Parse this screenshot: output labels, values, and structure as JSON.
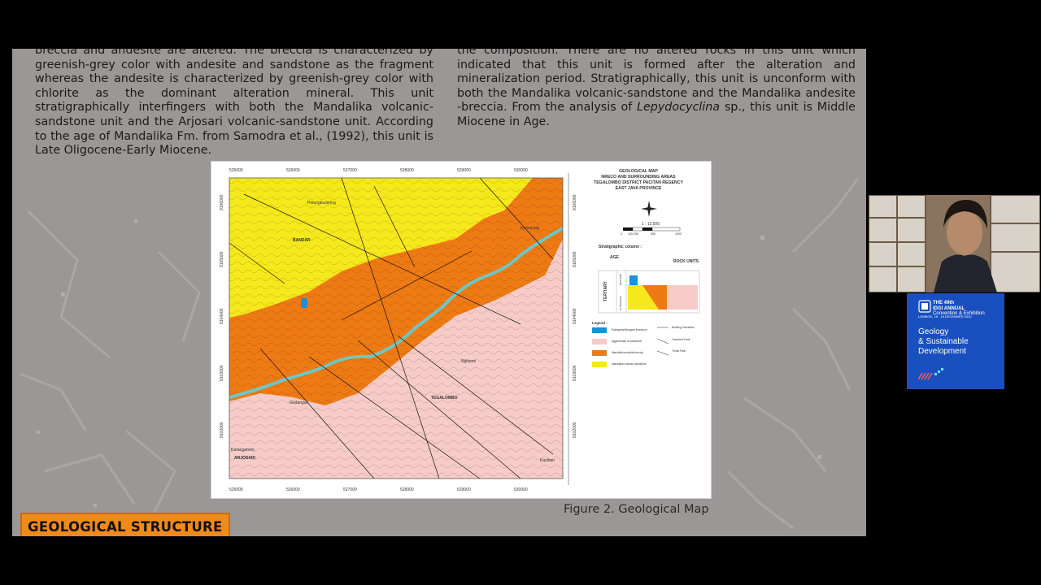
{
  "left_column": {
    "paragraph": "breccia and andesite are altered. The breccia is characterized by greenish-grey color with andesite and sandstone as the fragment whereas the andesite is characterized by greenish-grey color with chlorite as the dominant alteration mineral. This unit stratigraphically interfingers with both the Mandalika volcanic-sandstone unit and the Arjosari volcanic-sandstone unit. According to the age of Mandalika Fm. from Samodra et al., (1992), this unit is Late Oligocene-Early Miocene."
  },
  "right_column": {
    "part1": "the composition. There are no altered rocks in this unit which indicated that this unit is formed after the alteration and mineralization period. Stratigraphically, this unit is unconform with both the Mandalika volcanic-sandstone and the Mandalika andesite -breccia. From the analysis of ",
    "italic": "Lepydocyclina",
    "part2": " sp., this unit is Middle Miocene in Age."
  },
  "map": {
    "title": [
      "GEOLOGICAL MAP",
      "NRECO AND SURROUNDING AREAS",
      "TEGALOMBO DISTRICT PACITAN REGENCY",
      "EAST JAVA PROVINCE"
    ],
    "scale": "1 : 12.500",
    "scale_ticks": [
      "0",
      "125 250",
      "500",
      "1000"
    ],
    "x_ticks": [
      "525000",
      "526000",
      "527000",
      "528000",
      "529000",
      "530000"
    ],
    "y_ticks": [
      "9106000",
      "9105000",
      "9104000",
      "9103000",
      "9102000"
    ],
    "place_names": [
      "Petungkumiring",
      "BANDAR",
      "Kemurung",
      "TEGALOMBO",
      "Ngilumo",
      "Gedangan",
      "Karanganom",
      "ARJOSARI",
      "Kasihan"
    ],
    "strat_column_label": "Stratigraphic column :",
    "age_label": "AGE",
    "rock_units_label": "ROCK UNITS",
    "period": "TERTIARY",
    "epochs": [
      "MIOCENE",
      "OLIGOCENE"
    ],
    "legend_label": "Legend :",
    "legend_units": [
      {
        "label": "Paleogene/Neogene limestone",
        "color": "#1e8fd8"
      },
      {
        "label": "Agglomerate to sandstone",
        "color": "#f6c6c6"
      },
      {
        "label": "Mandalika andesite-breccia",
        "color": "#ef7a14"
      },
      {
        "label": "Mandalika volcanic-sandstone",
        "color": "#f7ef14"
      }
    ],
    "legend_symbols": [
      "Bedding Orientation",
      "Transform Fault",
      "Thrust Fault"
    ],
    "colors": {
      "yellow": "#f5e81c",
      "orange": "#ee7a14",
      "pink": "#f6cbc8",
      "river": "#6fc6c3",
      "limestone": "#1e8fd8"
    }
  },
  "figure_caption": "Figure 2. Geological Map",
  "section_badge": "GEOLOGICAL STRUCTURE",
  "promo": {
    "edition": "THE 49th",
    "name": "IDGI ANNUAL",
    "sub": "Convention & Exhibition",
    "dates": "LOMBOK, 15 - 16 DECEMBER 2020",
    "theme_line1": "Geology",
    "theme_line2": "& Sustainable",
    "theme_line3": "Development",
    "color": "#1a4fbf"
  }
}
